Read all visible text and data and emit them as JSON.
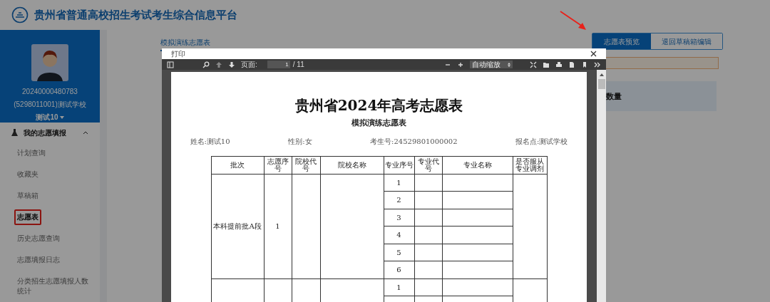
{
  "header": {
    "title": "贵州省普通高校招生考试考生综合信息平台"
  },
  "profile": {
    "id": "20240000480783",
    "school": "(5298011001)测试学校",
    "name": "测试10"
  },
  "nav": {
    "label": "我的志愿填报",
    "expanded": true,
    "items": [
      {
        "label": "计划查询",
        "selected": false
      },
      {
        "label": "收藏夹",
        "selected": false
      },
      {
        "label": "草稿箱",
        "selected": false
      },
      {
        "label": "志愿表",
        "selected": true
      },
      {
        "label": "历史志愿查询",
        "selected": false
      },
      {
        "label": "志愿填报日志",
        "selected": false
      },
      {
        "label": "分类招生志愿填报人数统计",
        "selected": false
      }
    ]
  },
  "main": {
    "tab": "模拟演练志愿表",
    "buttons": [
      {
        "label": "志愿表预览",
        "selected": true
      },
      {
        "label": "退回草稿箱编辑",
        "selected": false
      }
    ],
    "panel_text": "数量"
  },
  "dialog": {
    "title": "打印",
    "toolbar": {
      "page_label": "页面:",
      "page_value": "1",
      "page_total": "/ 11",
      "zoom": "自动缩放"
    },
    "document": {
      "title": "贵州省2024年高考志愿表",
      "subtitle": "模拟演练志愿表",
      "info": [
        "姓名:测试10",
        "性别:女",
        "考生号:24529801000002",
        "报名点:测试学校"
      ],
      "columns": [
        "批次",
        "志愿序号",
        "院校代号",
        "院校名称",
        "专业序号",
        "专业代号",
        "专业名称",
        "是否服从专业调剂"
      ],
      "groups": [
        {
          "batch": "本科提前批A段",
          "order": "1",
          "majors": [
            "1",
            "2",
            "3",
            "4",
            "5",
            "6"
          ]
        },
        {
          "majors": [
            "1"
          ]
        }
      ]
    }
  }
}
